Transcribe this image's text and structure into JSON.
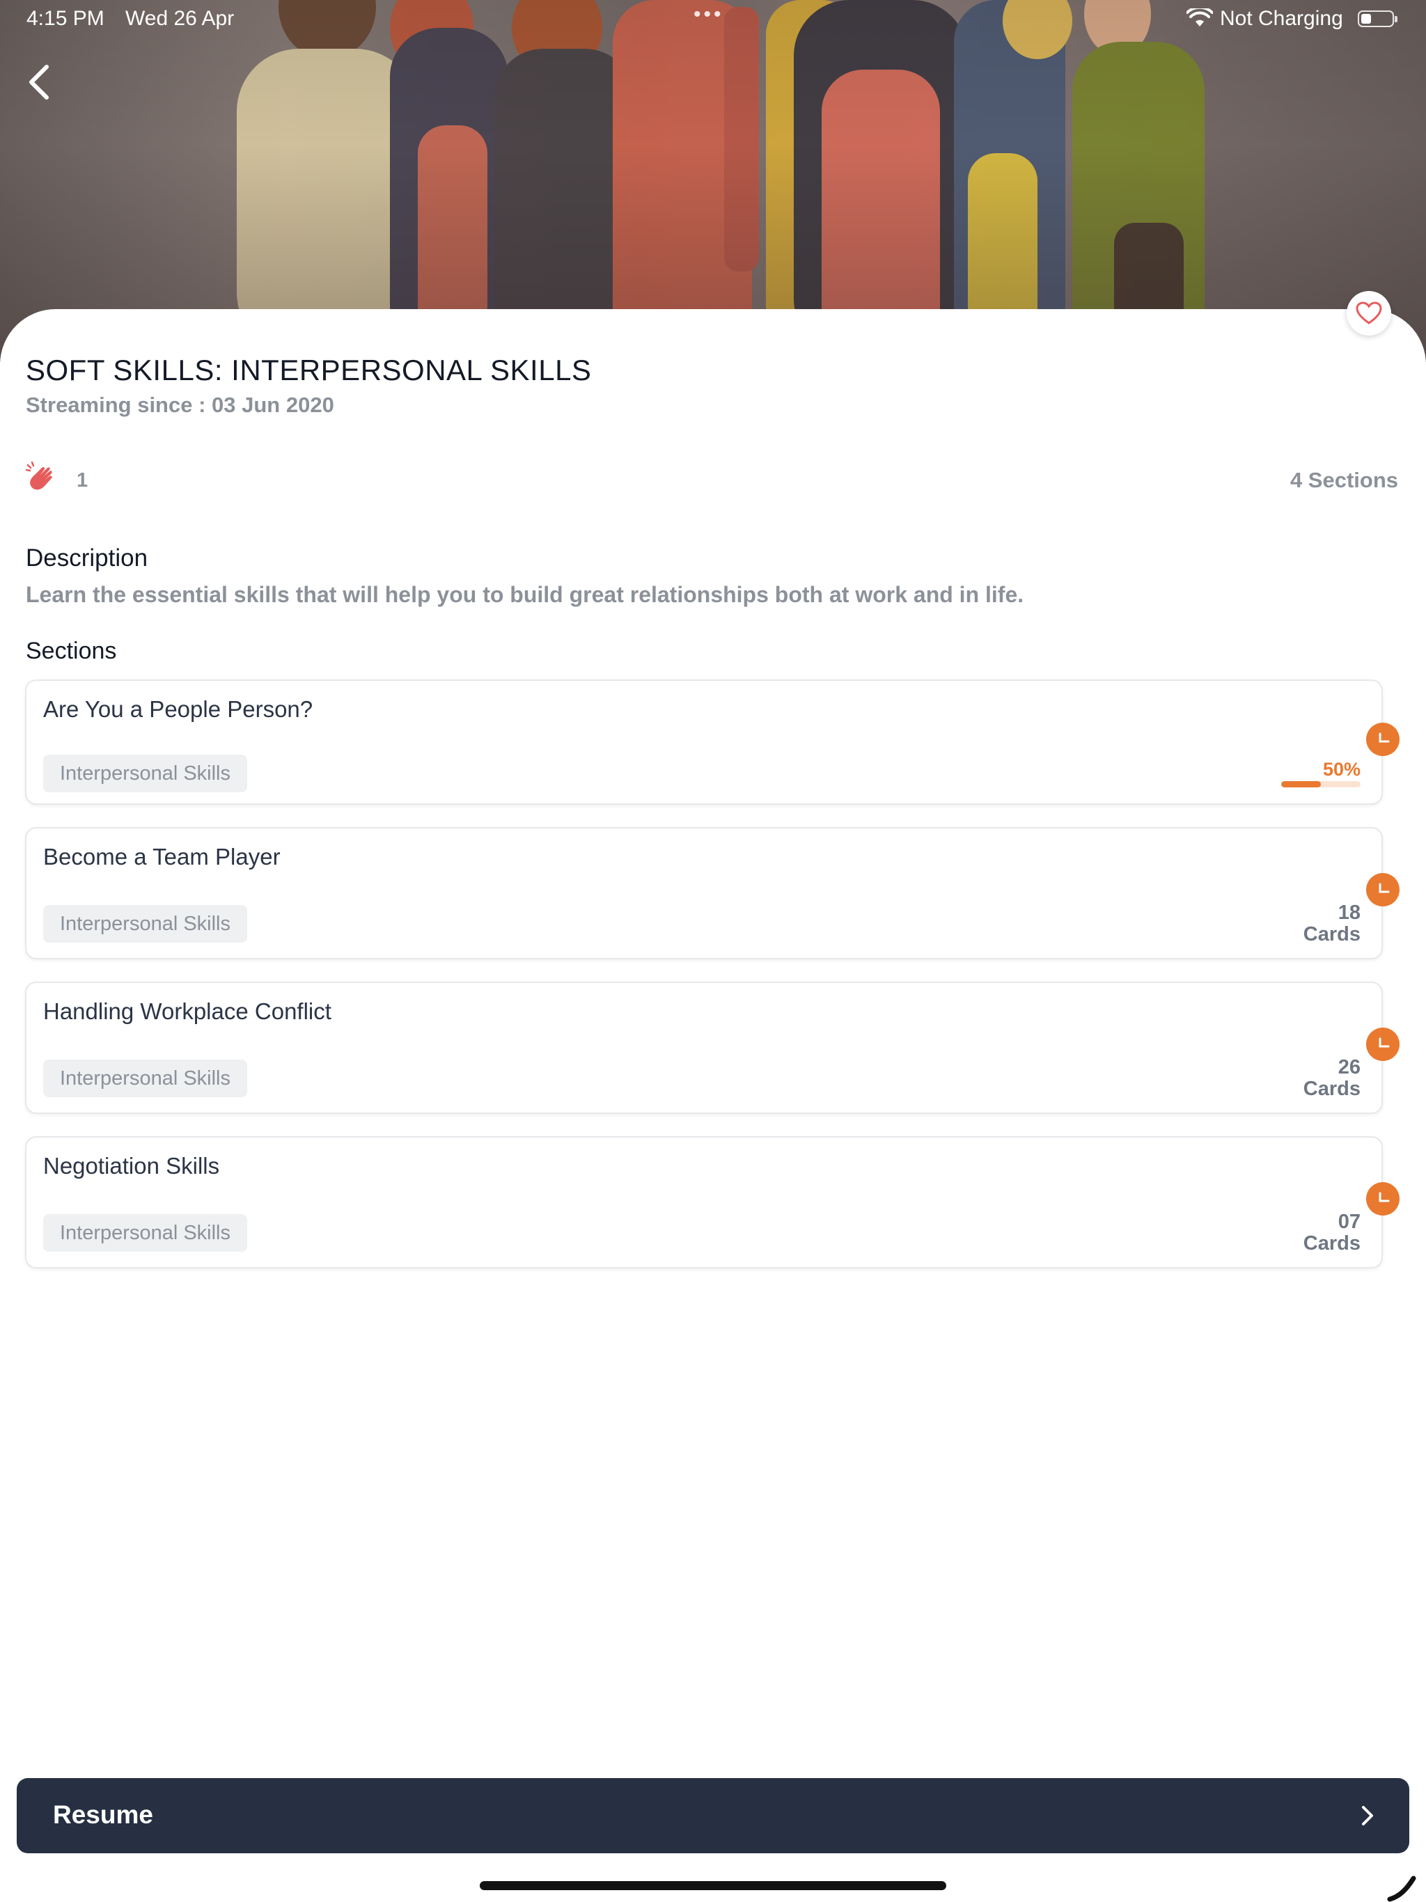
{
  "status_bar": {
    "time": "4:15 PM",
    "date": "Wed 26 Apr",
    "charging": "Not Charging",
    "dots": "•••"
  },
  "course": {
    "title": "SOFT SKILLS: INTERPERSONAL SKILLS",
    "streaming_since": "Streaming since : 03 Jun 2020",
    "claps": "1",
    "sections_count": "4 Sections",
    "description_heading": "Description",
    "description": "Learn the essential skills that will help you to build great relationships both at work and in life.",
    "sections_heading": "Sections"
  },
  "sections": [
    {
      "title": "Are You a People Person?",
      "tag": "Interpersonal Skills",
      "progress_label": "50%",
      "progress": 0.5
    },
    {
      "title": "Become a Team Player",
      "tag": "Interpersonal Skills",
      "count": "18",
      "unit": "Cards"
    },
    {
      "title": "Handling Workplace Conflict",
      "tag": "Interpersonal Skills",
      "count": "26",
      "unit": "Cards"
    },
    {
      "title": "Negotiation Skills",
      "tag": "Interpersonal Skills",
      "count": "07",
      "unit": "Cards"
    }
  ],
  "resume": {
    "label": "Resume"
  },
  "icons": {
    "back": "chevron-left-icon",
    "favorite": "heart-icon",
    "claps": "clap-icon",
    "section_status": "clock-icon",
    "resume": "chevron-right-icon"
  },
  "colors": {
    "accent": "#e9792f",
    "resume_bg": "#263042",
    "muted_text": "#8c9199",
    "heart": "#e65c5c"
  }
}
